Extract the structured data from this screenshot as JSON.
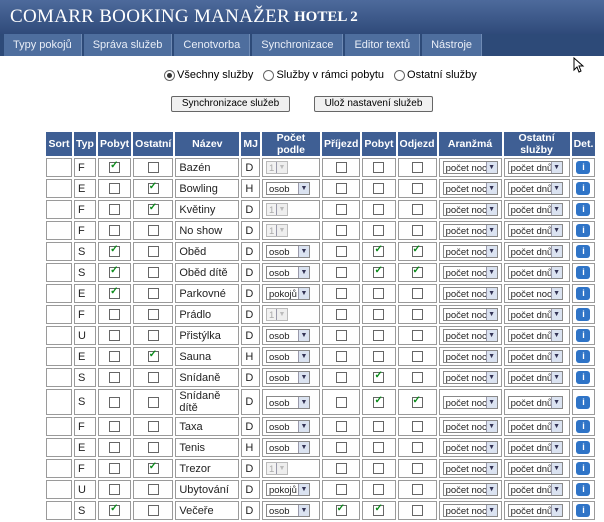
{
  "header": {
    "brand": "COMARR BOOKING MANAŽER",
    "hotel": "HOTEL 2"
  },
  "nav": [
    "Typy pokojů",
    "Správa služeb",
    "Cenotvorba",
    "Synchronizace",
    "Editor textů",
    "Nástroje"
  ],
  "filters": [
    {
      "label": "Všechny služby",
      "selected": true
    },
    {
      "label": "Služby v rámci pobytu",
      "selected": false
    },
    {
      "label": "Ostatní služby",
      "selected": false
    }
  ],
  "buttons": {
    "sync": "Synchronizace služeb",
    "save": "Ulož nastavení služeb"
  },
  "columns": [
    "Sort",
    "Typ",
    "Pobyt",
    "Ostatní",
    "Název",
    "MJ",
    "Počet podle",
    "Příjezd",
    "Pobyt",
    "Odjezd",
    "Aranžmá",
    "Ostatní služby",
    "Det."
  ],
  "rows": [
    {
      "typ": "F",
      "pobyt": true,
      "ostatni": false,
      "nazev": "Bazén",
      "mj": "D",
      "pocet": "1",
      "pocet_disabled": true,
      "prijezd": false,
      "pobyt2": false,
      "odjezd": false,
      "aranzma": "počet nocí",
      "ostatni_sluzby": "počet dnů"
    },
    {
      "typ": "E",
      "pobyt": false,
      "ostatni": true,
      "nazev": "Bowling",
      "mj": "H",
      "pocet": "osob",
      "pocet_disabled": false,
      "prijezd": false,
      "pobyt2": false,
      "odjezd": false,
      "aranzma": "počet nocí",
      "ostatni_sluzby": "počet dnů"
    },
    {
      "typ": "F",
      "pobyt": false,
      "ostatni": true,
      "nazev": "Květiny",
      "mj": "D",
      "pocet": "1",
      "pocet_disabled": true,
      "prijezd": false,
      "pobyt2": false,
      "odjezd": false,
      "aranzma": "počet nocí",
      "ostatni_sluzby": "počet dnů"
    },
    {
      "typ": "F",
      "pobyt": false,
      "ostatni": false,
      "nazev": "No show",
      "mj": "D",
      "pocet": "1",
      "pocet_disabled": true,
      "prijezd": false,
      "pobyt2": false,
      "odjezd": false,
      "aranzma": "počet nocí",
      "ostatni_sluzby": "počet dnů"
    },
    {
      "typ": "S",
      "pobyt": true,
      "ostatni": false,
      "nazev": "Oběd",
      "mj": "D",
      "pocet": "osob",
      "pocet_disabled": false,
      "prijezd": false,
      "pobyt2": true,
      "odjezd": true,
      "aranzma": "počet nocí",
      "ostatni_sluzby": "počet dnů"
    },
    {
      "typ": "S",
      "pobyt": true,
      "ostatni": false,
      "nazev": "Oběd dítě",
      "mj": "D",
      "pocet": "osob",
      "pocet_disabled": false,
      "prijezd": false,
      "pobyt2": true,
      "odjezd": true,
      "aranzma": "počet nocí",
      "ostatni_sluzby": "počet dnů"
    },
    {
      "typ": "E",
      "pobyt": true,
      "ostatni": false,
      "nazev": "Parkovné",
      "mj": "D",
      "pocet": "pokojů",
      "pocet_disabled": false,
      "prijezd": false,
      "pobyt2": false,
      "odjezd": false,
      "aranzma": "počet nocí",
      "ostatni_sluzby": "počet nocí"
    },
    {
      "typ": "F",
      "pobyt": false,
      "ostatni": false,
      "nazev": "Prádlo",
      "mj": "D",
      "pocet": "1",
      "pocet_disabled": true,
      "prijezd": false,
      "pobyt2": false,
      "odjezd": false,
      "aranzma": "počet nocí",
      "ostatni_sluzby": "počet dnů"
    },
    {
      "typ": "U",
      "pobyt": false,
      "ostatni": false,
      "nazev": "Přistýlka",
      "mj": "D",
      "pocet": "osob",
      "pocet_disabled": false,
      "prijezd": false,
      "pobyt2": false,
      "odjezd": false,
      "aranzma": "počet nocí",
      "ostatni_sluzby": "počet dnů"
    },
    {
      "typ": "E",
      "pobyt": false,
      "ostatni": true,
      "nazev": "Sauna",
      "mj": "H",
      "pocet": "osob",
      "pocet_disabled": false,
      "prijezd": false,
      "pobyt2": false,
      "odjezd": false,
      "aranzma": "počet nocí",
      "ostatni_sluzby": "počet dnů"
    },
    {
      "typ": "S",
      "pobyt": false,
      "ostatni": false,
      "nazev": "Snídaně",
      "mj": "D",
      "pocet": "osob",
      "pocet_disabled": false,
      "prijezd": false,
      "pobyt2": true,
      "odjezd": false,
      "aranzma": "počet nocí",
      "ostatni_sluzby": "počet dnů"
    },
    {
      "typ": "S",
      "pobyt": false,
      "ostatni": false,
      "nazev": "Snídaně dítě",
      "mj": "D",
      "pocet": "osob",
      "pocet_disabled": false,
      "prijezd": false,
      "pobyt2": true,
      "odjezd": true,
      "aranzma": "počet nocí",
      "ostatni_sluzby": "počet dnů"
    },
    {
      "typ": "F",
      "pobyt": false,
      "ostatni": false,
      "nazev": "Taxa",
      "mj": "D",
      "pocet": "osob",
      "pocet_disabled": false,
      "prijezd": false,
      "pobyt2": false,
      "odjezd": false,
      "aranzma": "počet nocí",
      "ostatni_sluzby": "počet dnů"
    },
    {
      "typ": "E",
      "pobyt": false,
      "ostatni": false,
      "nazev": "Tenis",
      "mj": "H",
      "pocet": "osob",
      "pocet_disabled": false,
      "prijezd": false,
      "pobyt2": false,
      "odjezd": false,
      "aranzma": "počet nocí",
      "ostatni_sluzby": "počet dnů"
    },
    {
      "typ": "F",
      "pobyt": false,
      "ostatni": true,
      "nazev": "Trezor",
      "mj": "D",
      "pocet": "1",
      "pocet_disabled": true,
      "prijezd": false,
      "pobyt2": false,
      "odjezd": false,
      "aranzma": "počet nocí",
      "ostatni_sluzby": "počet dnů"
    },
    {
      "typ": "U",
      "pobyt": false,
      "ostatni": false,
      "nazev": "Ubytování",
      "mj": "D",
      "pocet": "pokojů",
      "pocet_disabled": false,
      "prijezd": false,
      "pobyt2": false,
      "odjezd": false,
      "aranzma": "počet nocí",
      "ostatni_sluzby": "počet dnů"
    },
    {
      "typ": "S",
      "pobyt": true,
      "ostatni": false,
      "nazev": "Večeře",
      "mj": "D",
      "pocet": "osob",
      "pocet_disabled": false,
      "prijezd": true,
      "pobyt2": true,
      "odjezd": false,
      "aranzma": "počet nocí",
      "ostatni_sluzby": "počet dnů"
    }
  ],
  "icons": {
    "detail": "info-icon",
    "cursor": "mouse-pointer-icon"
  },
  "colors": {
    "header": "#3f5f94",
    "nav": "#2d4a78",
    "check": "#0a8a1a",
    "info": "#2f74c7"
  }
}
